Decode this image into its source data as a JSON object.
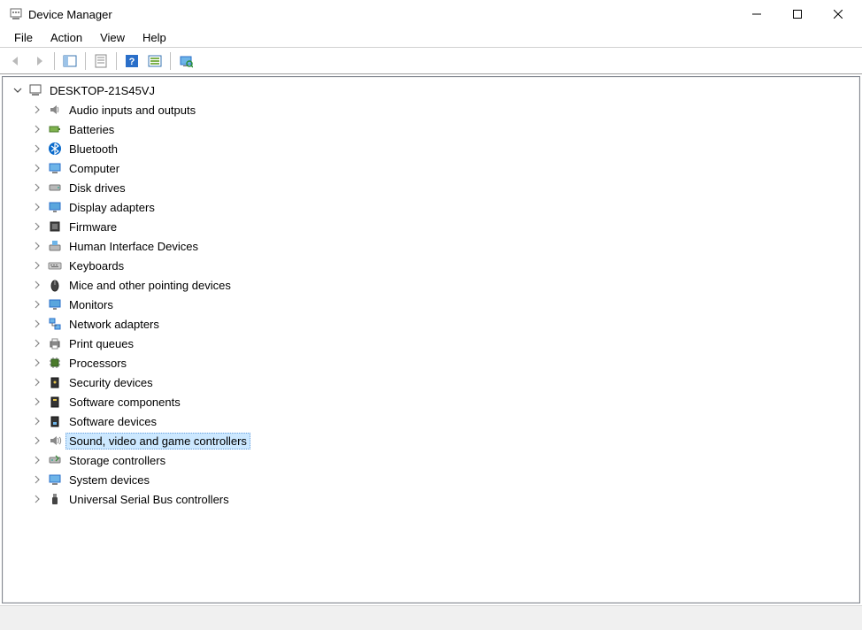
{
  "window": {
    "title": "Device Manager"
  },
  "menubar": {
    "items": [
      "File",
      "Action",
      "View",
      "Help"
    ]
  },
  "toolbar": {
    "back": "Back",
    "forward": "Forward",
    "show_hide": "Show/Hide Console Tree",
    "properties": "Properties",
    "help": "Help",
    "export": "Export List",
    "scan": "Scan for hardware changes"
  },
  "tree": {
    "root": {
      "label": "DESKTOP-21S45VJ",
      "expanded": true,
      "icon": "computer-root-icon"
    },
    "children": [
      {
        "label": "Audio inputs and outputs",
        "icon": "audio-icon",
        "selected": false
      },
      {
        "label": "Batteries",
        "icon": "battery-icon",
        "selected": false
      },
      {
        "label": "Bluetooth",
        "icon": "bluetooth-icon",
        "selected": false
      },
      {
        "label": "Computer",
        "icon": "computer-icon",
        "selected": false
      },
      {
        "label": "Disk drives",
        "icon": "disk-icon",
        "selected": false
      },
      {
        "label": "Display adapters",
        "icon": "display-icon",
        "selected": false
      },
      {
        "label": "Firmware",
        "icon": "firmware-icon",
        "selected": false
      },
      {
        "label": "Human Interface Devices",
        "icon": "hid-icon",
        "selected": false
      },
      {
        "label": "Keyboards",
        "icon": "keyboard-icon",
        "selected": false
      },
      {
        "label": "Mice and other pointing devices",
        "icon": "mouse-icon",
        "selected": false
      },
      {
        "label": "Monitors",
        "icon": "monitor-icon",
        "selected": false
      },
      {
        "label": "Network adapters",
        "icon": "network-icon",
        "selected": false
      },
      {
        "label": "Print queues",
        "icon": "printer-icon",
        "selected": false
      },
      {
        "label": "Processors",
        "icon": "processor-icon",
        "selected": false
      },
      {
        "label": "Security devices",
        "icon": "security-icon",
        "selected": false
      },
      {
        "label": "Software components",
        "icon": "software-comp-icon",
        "selected": false
      },
      {
        "label": "Software devices",
        "icon": "software-dev-icon",
        "selected": false
      },
      {
        "label": "Sound, video and game controllers",
        "icon": "sound-icon",
        "selected": true
      },
      {
        "label": "Storage controllers",
        "icon": "storage-icon",
        "selected": false
      },
      {
        "label": "System devices",
        "icon": "system-icon",
        "selected": false
      },
      {
        "label": "Universal Serial Bus controllers",
        "icon": "usb-icon",
        "selected": false
      }
    ]
  }
}
